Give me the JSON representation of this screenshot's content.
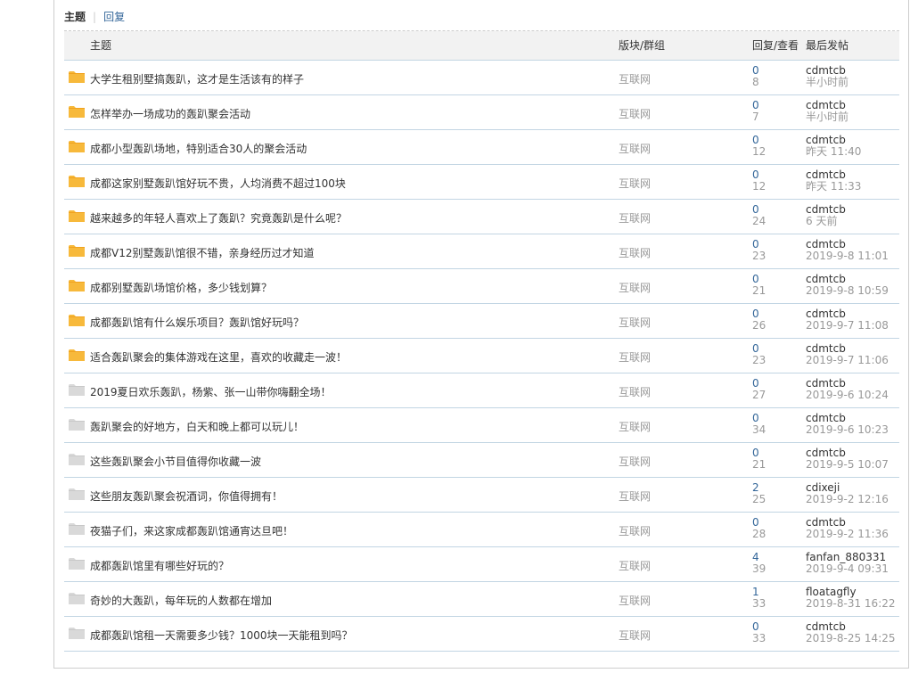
{
  "tabs": {
    "topic": "主题",
    "reply": "回复"
  },
  "headers": {
    "topic": "主题",
    "forum": "版块/群组",
    "stats": "回复/查看",
    "last": "最后发帖"
  },
  "colors": {
    "folder_new": "#f7b93b",
    "folder_old": "#d9d9d9",
    "reply_count": "#336699"
  },
  "rows": [
    {
      "title": "大学生租别墅搞轰趴，这才是生活该有的样子",
      "forum": "互联网",
      "replies": "0",
      "views": "8",
      "last_user": "cdmtcb",
      "last_time": "半小时前",
      "icon": "folder-new"
    },
    {
      "title": "怎样举办一场成功的轰趴聚会活动",
      "forum": "互联网",
      "replies": "0",
      "views": "7",
      "last_user": "cdmtcb",
      "last_time": "半小时前",
      "icon": "folder-new"
    },
    {
      "title": "成都小型轰趴场地，特别适合30人的聚会活动",
      "forum": "互联网",
      "replies": "0",
      "views": "12",
      "last_user": "cdmtcb",
      "last_time": "昨天 11:40",
      "icon": "folder-new"
    },
    {
      "title": "成都这家别墅轰趴馆好玩不贵，人均消费不超过100块",
      "forum": "互联网",
      "replies": "0",
      "views": "12",
      "last_user": "cdmtcb",
      "last_time": "昨天 11:33",
      "icon": "folder-new"
    },
    {
      "title": "越来越多的年轻人喜欢上了轰趴？究竟轰趴是什么呢？",
      "forum": "互联网",
      "replies": "0",
      "views": "24",
      "last_user": "cdmtcb",
      "last_time": "6 天前",
      "icon": "folder-new"
    },
    {
      "title": "成都V12别墅轰趴馆很不错，亲身经历过才知道",
      "forum": "互联网",
      "replies": "0",
      "views": "23",
      "last_user": "cdmtcb",
      "last_time": "2019-9-8 11:01",
      "icon": "folder-new"
    },
    {
      "title": "成都别墅轰趴场馆价格，多少钱划算？",
      "forum": "互联网",
      "replies": "0",
      "views": "21",
      "last_user": "cdmtcb",
      "last_time": "2019-9-8 10:59",
      "icon": "folder-new"
    },
    {
      "title": "成都轰趴馆有什么娱乐项目？轰趴馆好玩吗？",
      "forum": "互联网",
      "replies": "0",
      "views": "26",
      "last_user": "cdmtcb",
      "last_time": "2019-9-7 11:08",
      "icon": "folder-new"
    },
    {
      "title": "适合轰趴聚会的集体游戏在这里，喜欢的收藏走一波！",
      "forum": "互联网",
      "replies": "0",
      "views": "23",
      "last_user": "cdmtcb",
      "last_time": "2019-9-7 11:06",
      "icon": "folder-new"
    },
    {
      "title": "2019夏日欢乐轰趴，杨紫、张一山带你嗨翻全场！",
      "forum": "互联网",
      "replies": "0",
      "views": "27",
      "last_user": "cdmtcb",
      "last_time": "2019-9-6 10:24",
      "icon": "folder-old"
    },
    {
      "title": "轰趴聚会的好地方，白天和晚上都可以玩儿！",
      "forum": "互联网",
      "replies": "0",
      "views": "34",
      "last_user": "cdmtcb",
      "last_time": "2019-9-6 10:23",
      "icon": "folder-old"
    },
    {
      "title": "这些轰趴聚会小节目值得你收藏一波",
      "forum": "互联网",
      "replies": "0",
      "views": "21",
      "last_user": "cdmtcb",
      "last_time": "2019-9-5 10:07",
      "icon": "folder-old"
    },
    {
      "title": "这些朋友轰趴聚会祝酒词，你值得拥有！",
      "forum": "互联网",
      "replies": "2",
      "views": "25",
      "last_user": "cdixeji",
      "last_time": "2019-9-2 12:16",
      "icon": "folder-old"
    },
    {
      "title": "夜猫子们，来这家成都轰趴馆通宵达旦吧！",
      "forum": "互联网",
      "replies": "0",
      "views": "28",
      "last_user": "cdmtcb",
      "last_time": "2019-9-2 11:36",
      "icon": "folder-old"
    },
    {
      "title": "成都轰趴馆里有哪些好玩的？",
      "forum": "互联网",
      "replies": "4",
      "views": "39",
      "last_user": "fanfan_880331",
      "last_time": "2019-9-4 09:31",
      "icon": "folder-old"
    },
    {
      "title": "奇妙的大轰趴，每年玩的人数都在增加",
      "forum": "互联网",
      "replies": "1",
      "views": "33",
      "last_user": "floatagfly",
      "last_time": "2019-8-31 16:22",
      "icon": "folder-old"
    },
    {
      "title": "成都轰趴馆租一天需要多少钱？1000块一天能租到吗？",
      "forum": "互联网",
      "replies": "0",
      "views": "33",
      "last_user": "cdmtcb",
      "last_time": "2019-8-25 14:25",
      "icon": "folder-old"
    }
  ]
}
